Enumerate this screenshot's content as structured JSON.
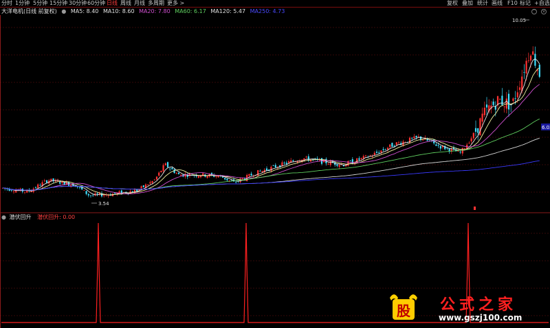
{
  "toolbar": {
    "periods": [
      "分时",
      "1分钟",
      "5分钟",
      "15分钟",
      "30分钟",
      "60分钟",
      "日线",
      "周线",
      "月线",
      "多周期",
      "更多 >"
    ],
    "active": "日线",
    "right": [
      "复权",
      "叠加",
      "统计",
      "画线",
      "F10",
      "标记",
      "+自选"
    ]
  },
  "info": {
    "title": "大洋电机(日线 前复权)",
    "ma": [
      {
        "label": "MA5: 8.40",
        "color": "#e0e0e0"
      },
      {
        "label": "MA10: 8.60",
        "color": "#e0e0e0"
      },
      {
        "label": "MA20: 7.80",
        "color": "#d050d0"
      },
      {
        "label": "MA60: 6.17",
        "color": "#60d060"
      },
      {
        "label": "MA120: 5.47",
        "color": "#e0e0e0"
      },
      {
        "label": "MA250: 4.73",
        "color": "#4a4aff"
      }
    ]
  },
  "price_labels": {
    "high": "10.05",
    "low": "3.54",
    "right_tag": "6.02"
  },
  "indicator": {
    "title": "潜伏回升",
    "value_label": "潜伏回升: 0.00"
  },
  "watermark": {
    "logo": "股",
    "brand": "公式之家",
    "url": "www.gszj100.com"
  },
  "colors": {
    "up": "#ff3232",
    "down": "#40e0ff",
    "ma20": "#d050d0",
    "ma60": "#60d060",
    "ma250": "#3a3aff",
    "grid": "#6b0f0f",
    "signal": "#ff2020"
  },
  "chart_data": {
    "type": "candlestick",
    "price_range": [
      3.3,
      10.6
    ],
    "close_trend": [
      [
        0,
        4.0
      ],
      [
        40,
        3.85
      ],
      [
        70,
        4.3
      ],
      [
        110,
        4.1
      ],
      [
        130,
        3.7
      ],
      [
        160,
        3.75
      ],
      [
        200,
        3.9
      ],
      [
        225,
        4.3
      ],
      [
        240,
        4.9
      ],
      [
        260,
        4.5
      ],
      [
        290,
        4.5
      ],
      [
        320,
        4.45
      ],
      [
        340,
        4.2
      ],
      [
        375,
        4.6
      ],
      [
        410,
        4.9
      ],
      [
        440,
        5.15
      ],
      [
        470,
        5.0
      ],
      [
        500,
        4.9
      ],
      [
        540,
        5.25
      ],
      [
        575,
        5.7
      ],
      [
        610,
        5.95
      ],
      [
        640,
        5.6
      ],
      [
        670,
        5.35
      ],
      [
        690,
        6.1
      ],
      [
        705,
        6.9
      ],
      [
        725,
        7.4
      ],
      [
        745,
        7.2
      ],
      [
        762,
        8.6
      ],
      [
        772,
        9.4
      ],
      [
        785,
        8.4
      ]
    ],
    "signal_positions": [
      143,
      358,
      681
    ]
  }
}
